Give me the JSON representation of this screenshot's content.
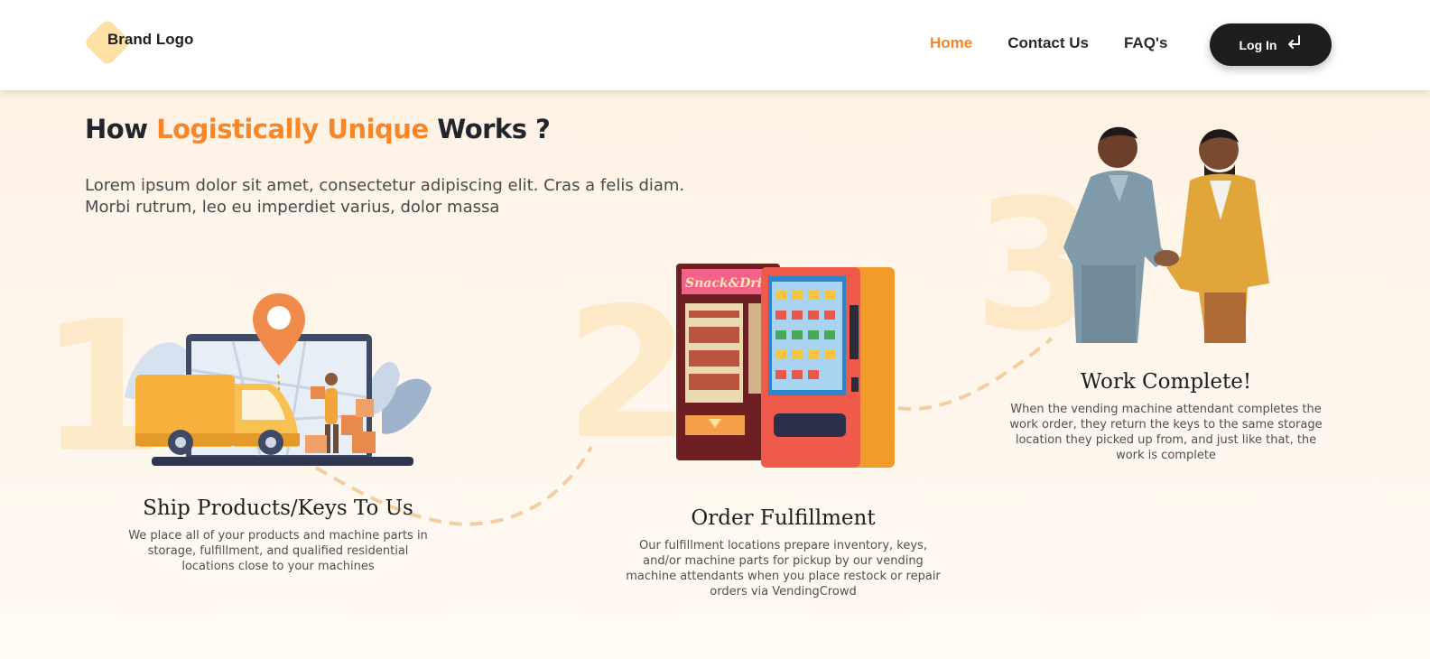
{
  "header": {
    "brand": "Brand Logo",
    "nav": [
      {
        "label": "Home",
        "active": true
      },
      {
        "label": "Contact Us",
        "active": false
      },
      {
        "label": "FAQ's",
        "active": false
      }
    ],
    "login_label": "Log In",
    "login_icon": "enter-arrow-icon"
  },
  "section": {
    "heading_prefix": "How",
    "heading_accent": "Logistically Unique",
    "heading_suffix": "Works ?",
    "intro": "Lorem ipsum dolor sit amet, consectetur adipiscing elit. Cras a felis diam. Morbi rutrum, leo eu imperdiet varius, dolor massa"
  },
  "steps": [
    {
      "number": "1",
      "title": "Ship Products/Keys To Us",
      "description": "We place all of your products and machine parts in storage, fulfillment, and qualified residential locations close to your machines",
      "illustration": "delivery-truck-illustration"
    },
    {
      "number": "2",
      "title": "Order Fulfillment",
      "description": "Our fulfillment locations prepare inventory, keys, and/or machine parts for pickup by our vending machine attendants when you place restock or repair orders via VendingCrowd",
      "illustration": "vending-machines-illustration",
      "sign_text": "Snack&Drink"
    },
    {
      "number": "3",
      "title": "Work Complete!",
      "description": "When the vending machine attendant completes the work order, they return the keys to the same storage location they picked up from, and just like that, the work is complete",
      "illustration": "handshake-illustration"
    }
  ],
  "colors": {
    "accent": "#f5862a",
    "dark": "#1e1e1e",
    "background": "#fef3e6"
  }
}
